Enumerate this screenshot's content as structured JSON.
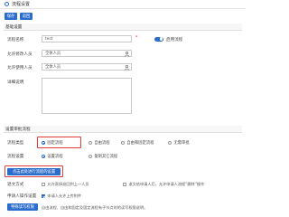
{
  "window": {
    "title": "流程设置"
  },
  "toolbar": {
    "save_label": "保存",
    "back_label": "返回"
  },
  "basic": {
    "section_title": "基础设置",
    "name_label": "流程名称",
    "name_value": "test",
    "required_mark": "*",
    "enable_label": "启用流程",
    "modifier_label": "允许修改人员",
    "modifier_value": "全体人员",
    "user_label": "允许使用人员",
    "user_value": "全体人员",
    "desc_label": "详细说明"
  },
  "advanced": {
    "section_title": "设置审批流程",
    "type_label": "流程类型",
    "type_options": [
      "固定流程",
      "自由流程",
      "自由和固定流程",
      "无需审批"
    ],
    "setting_label": "流程设置",
    "setting_options": [
      "设置流程",
      "复制其它流程"
    ],
    "primary_button": "点击此处进行流程的设置",
    "transfer_label": "退文方式",
    "transfer_opt1": "允许直接退回到上一人员",
    "transfer_opt2": "退文给申请人后，允许申请人流程”删除”操作",
    "apply_label": "申请人操作设置",
    "apply_opt1": "申请人允许上传附件",
    "special_button": "特殊读写权限",
    "special_desc": "自由流程、自由和固定及固定流程有子节点时的读写权限说明。"
  },
  "colors": {
    "accent": "#2b6dcc",
    "highlight": "#e23b3b"
  }
}
